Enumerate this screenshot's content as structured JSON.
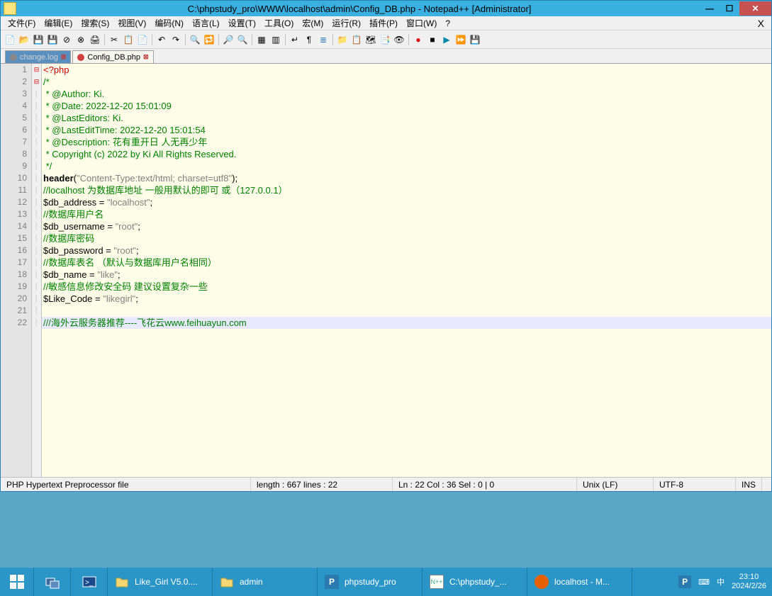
{
  "title": "C:\\phpstudy_pro\\WWW\\localhost\\admin\\Config_DB.php - Notepad++ [Administrator]",
  "menu": [
    "文件(F)",
    "编辑(E)",
    "搜索(S)",
    "视图(V)",
    "编码(N)",
    "语言(L)",
    "设置(T)",
    "工具(O)",
    "宏(M)",
    "运行(R)",
    "插件(P)",
    "窗口(W)",
    "?"
  ],
  "tabs": [
    {
      "label": "change.log",
      "active": false
    },
    {
      "label": "Config_DB.php",
      "active": true
    }
  ],
  "code": {
    "lines": [
      {
        "n": 1,
        "fold": "⊟",
        "seg": [
          {
            "c": "c-tag",
            "t": "<?php"
          }
        ]
      },
      {
        "n": 2,
        "fold": "⊟",
        "seg": [
          {
            "c": "c-cmt",
            "t": "/*"
          }
        ]
      },
      {
        "n": 3,
        "seg": [
          {
            "c": "c-cmt",
            "t": " * @Author: Ki."
          }
        ]
      },
      {
        "n": 4,
        "seg": [
          {
            "c": "c-cmt",
            "t": " * @Date: 2022-12-20 15:01:09"
          }
        ]
      },
      {
        "n": 5,
        "seg": [
          {
            "c": "c-cmt",
            "t": " * @LastEditors: Ki."
          }
        ]
      },
      {
        "n": 6,
        "seg": [
          {
            "c": "c-cmt",
            "t": " * @LastEditTime: 2022-12-20 15:01:54"
          }
        ]
      },
      {
        "n": 7,
        "seg": [
          {
            "c": "c-cmt",
            "t": " * @Description: 花有重开日 人无再少年"
          }
        ]
      },
      {
        "n": 8,
        "seg": [
          {
            "c": "c-cmt",
            "t": " * Copyright (c) 2022 by Ki All Rights Reserved."
          }
        ]
      },
      {
        "n": 9,
        "seg": [
          {
            "c": "c-cmt",
            "t": " */"
          }
        ]
      },
      {
        "n": 10,
        "seg": [
          {
            "c": "c-func",
            "t": "header"
          },
          {
            "c": "",
            "t": "("
          },
          {
            "c": "c-str",
            "t": "\"Content-Type:text/html; charset=utf8\""
          },
          {
            "c": "",
            "t": ");"
          }
        ]
      },
      {
        "n": 11,
        "seg": [
          {
            "c": "c-cmt",
            "t": "//localhost 为数据库地址 一般用默认的即可 或（127.0.0.1）"
          }
        ]
      },
      {
        "n": 12,
        "seg": [
          {
            "c": "c-var",
            "t": "$db_address"
          },
          {
            "c": "",
            "t": " = "
          },
          {
            "c": "c-str",
            "t": "\"localhost\""
          },
          {
            "c": "",
            "t": ";"
          }
        ]
      },
      {
        "n": 13,
        "seg": [
          {
            "c": "c-cmt",
            "t": "//数据库用户名"
          }
        ]
      },
      {
        "n": 14,
        "seg": [
          {
            "c": "c-var",
            "t": "$db_username"
          },
          {
            "c": "",
            "t": " = "
          },
          {
            "c": "c-str",
            "t": "\"root\""
          },
          {
            "c": "",
            "t": ";"
          }
        ]
      },
      {
        "n": 15,
        "seg": [
          {
            "c": "c-cmt",
            "t": "//数据库密码"
          }
        ]
      },
      {
        "n": 16,
        "seg": [
          {
            "c": "c-var",
            "t": "$db_password"
          },
          {
            "c": "",
            "t": " = "
          },
          {
            "c": "c-str",
            "t": "\"root\""
          },
          {
            "c": "",
            "t": ";"
          }
        ]
      },
      {
        "n": 17,
        "seg": [
          {
            "c": "c-cmt",
            "t": "//数据库表名 （默认与数据库用户名相同）"
          }
        ]
      },
      {
        "n": 18,
        "seg": [
          {
            "c": "c-var",
            "t": "$db_name"
          },
          {
            "c": "",
            "t": " = "
          },
          {
            "c": "c-str",
            "t": "\"like\""
          },
          {
            "c": "",
            "t": ";"
          }
        ]
      },
      {
        "n": 19,
        "seg": [
          {
            "c": "c-cmt",
            "t": "//敏感信息修改安全码 建议设置复杂一些"
          }
        ]
      },
      {
        "n": 20,
        "seg": [
          {
            "c": "c-var",
            "t": "$Like_Code"
          },
          {
            "c": "",
            "t": " = "
          },
          {
            "c": "c-str",
            "t": "\"likegirl\""
          },
          {
            "c": "",
            "t": ";"
          }
        ]
      },
      {
        "n": 21,
        "seg": [
          {
            "c": "",
            "t": ""
          }
        ]
      },
      {
        "n": 22,
        "hl": true,
        "seg": [
          {
            "c": "c-cmt",
            "t": "///海外云服务器推荐----飞花云www.feihuayun.com"
          }
        ]
      }
    ]
  },
  "status": {
    "type": "PHP Hypertext Preprocessor file",
    "length": "length : 667    lines : 22",
    "pos": "Ln : 22    Col : 36    Sel : 0 | 0",
    "eol": "Unix (LF)",
    "enc": "UTF-8",
    "ins": "INS"
  },
  "taskbar": {
    "tasks": [
      {
        "label": "Like_Girl V5.0....",
        "icon": "folder"
      },
      {
        "label": "admin",
        "icon": "folder"
      },
      {
        "label": "phpstudy_pro",
        "icon": "P"
      },
      {
        "label": "C:\\phpstudy_...",
        "icon": "npp"
      },
      {
        "label": "localhost - M...",
        "icon": "ff"
      }
    ],
    "time": "23:10",
    "date": "2024/2/26"
  }
}
